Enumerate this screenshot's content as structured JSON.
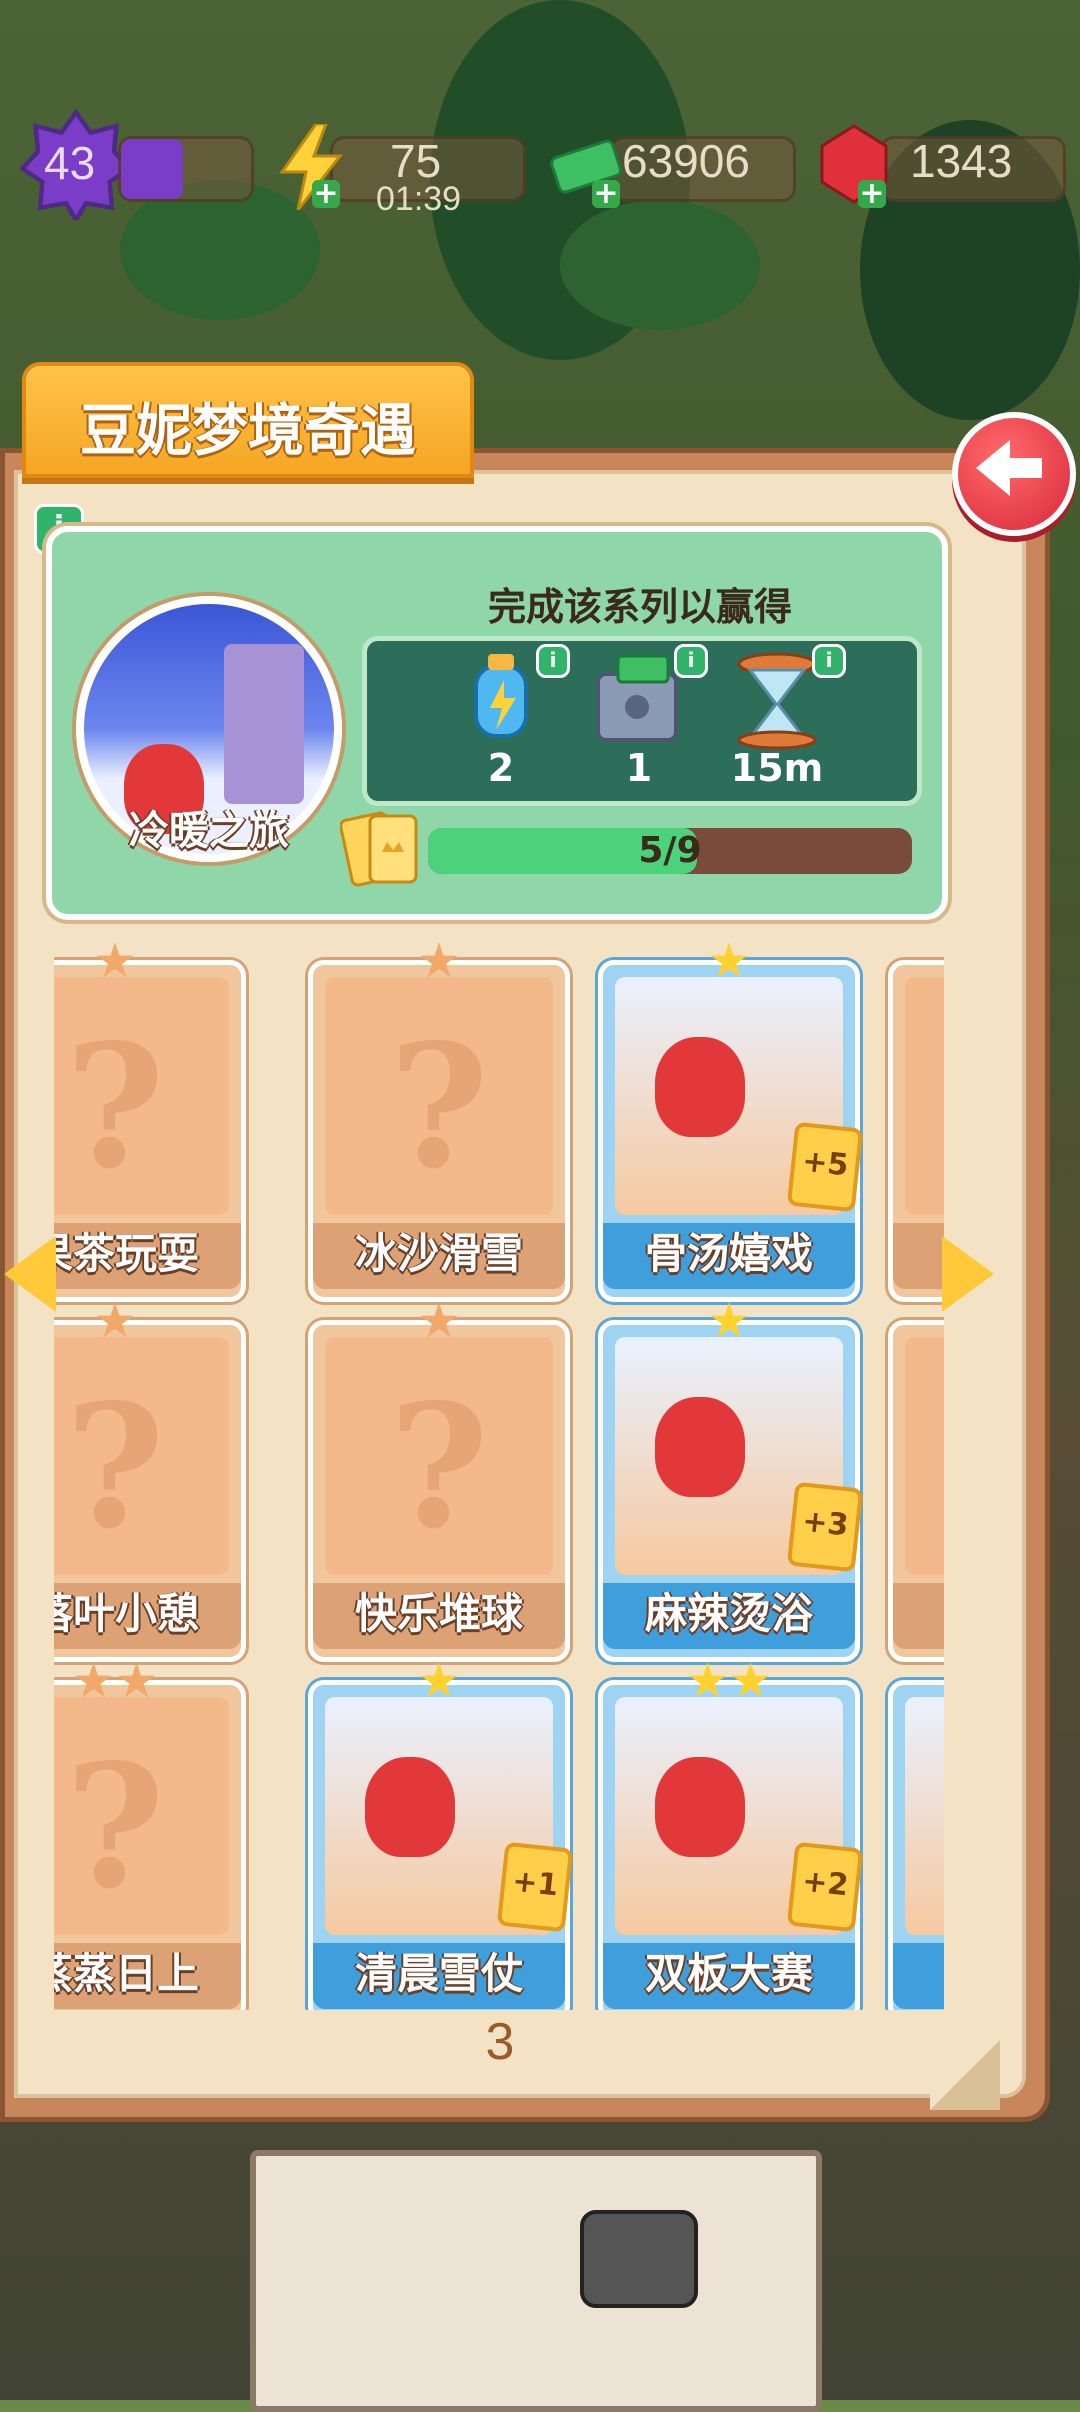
{
  "hud": {
    "level": "43",
    "energy": "75",
    "energy_timer": "01:39",
    "cash": "63906",
    "gems": "1343",
    "icons": [
      "level-star-icon",
      "energy-bolt-icon",
      "cash-icon",
      "gem-icon"
    ]
  },
  "title": "豆妮梦境奇遇",
  "series": {
    "name": "冷暖之旅",
    "reward_title": "完成该系列以赢得",
    "rewards": [
      {
        "icon": "energy-bottle-icon",
        "value": "2"
      },
      {
        "icon": "cash-safe-icon",
        "value": "1"
      },
      {
        "icon": "hourglass-icon",
        "value": "15m"
      }
    ],
    "progress_text": "5/9",
    "progress_fraction": 0.556
  },
  "cards": [
    {
      "label": "果茶玩耍",
      "stars": "★",
      "locked": true
    },
    {
      "label": "冰沙滑雪",
      "stars": "★",
      "locked": true
    },
    {
      "label": "骨汤嬉戏",
      "stars": "★",
      "locked": false,
      "bonus": "+5"
    },
    {
      "label": "纟",
      "stars": "",
      "locked": true
    },
    {
      "label": "落叶小憩",
      "stars": "★",
      "locked": true
    },
    {
      "label": "快乐堆球",
      "stars": "★",
      "locked": true
    },
    {
      "label": "麻辣烫浴",
      "stars": "★",
      "locked": false,
      "bonus": "+3"
    },
    {
      "label": "冒",
      "stars": "",
      "locked": true
    },
    {
      "label": "蒸蒸日上",
      "stars": "★★",
      "locked": true
    },
    {
      "label": "清晨雪仗",
      "stars": "★",
      "locked": false,
      "bonus": "+1"
    },
    {
      "label": "双板大赛",
      "stars": "★★",
      "locked": false,
      "bonus": "+2"
    },
    {
      "label": "雪",
      "stars": "",
      "locked": false
    }
  ],
  "question_mark": "?",
  "page_number": "3",
  "colors": {
    "accent": "#ffc93a",
    "back_button": "#d8293a",
    "progress": "#4cd27a"
  }
}
